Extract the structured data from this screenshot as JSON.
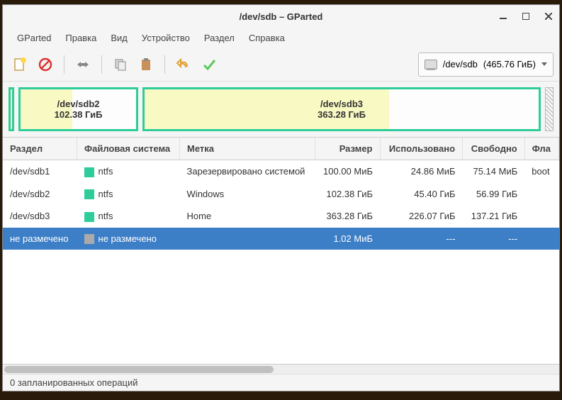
{
  "window": {
    "title": "/dev/sdb – GParted"
  },
  "menu": [
    "GParted",
    "Правка",
    "Вид",
    "Устройство",
    "Раздел",
    "Справка"
  ],
  "device": {
    "name": "/dev/sdb",
    "size": "(465.76 ГиБ)"
  },
  "partition_graphic": [
    {
      "name": "/dev/sdb2",
      "size": "102.38 ГиБ",
      "width_pct": 22,
      "fill_pct": 45
    },
    {
      "name": "/dev/sdb3",
      "size": "363.28 ГиБ",
      "width_pct": 75,
      "fill_pct": 62
    }
  ],
  "columns": {
    "partition": "Раздел",
    "filesystem": "Файловая система",
    "label": "Метка",
    "size": "Размер",
    "used": "Использовано",
    "free": "Свободно",
    "flags": "Фла"
  },
  "rows": [
    {
      "partition": "/dev/sdb1",
      "fs": "ntfs",
      "label": "Зарезервировано системой",
      "size": "100.00 МиБ",
      "used": "24.86 МиБ",
      "free": "75.14 МиБ",
      "flags": "boot",
      "swatch": "green"
    },
    {
      "partition": "/dev/sdb2",
      "fs": "ntfs",
      "label": "Windows",
      "size": "102.38 ГиБ",
      "used": "45.40 ГиБ",
      "free": "56.99 ГиБ",
      "flags": "",
      "swatch": "green"
    },
    {
      "partition": "/dev/sdb3",
      "fs": "ntfs",
      "label": "Home",
      "size": "363.28 ГиБ",
      "used": "226.07 ГиБ",
      "free": "137.21 ГиБ",
      "flags": "",
      "swatch": "green"
    },
    {
      "partition": "не размечено",
      "fs": "не размечено",
      "label": "",
      "size": "1.02 МиБ",
      "used": "---",
      "free": "---",
      "flags": "",
      "swatch": "gray",
      "selected": true
    }
  ],
  "status": "0 запланированных операций"
}
